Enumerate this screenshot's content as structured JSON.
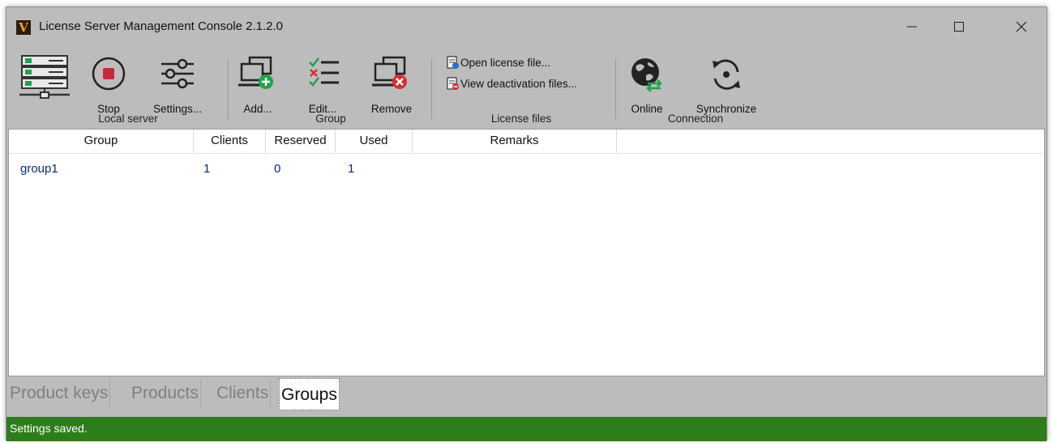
{
  "window": {
    "title": "License Server Management Console 2.1.2.0",
    "controls": {
      "minimize": "minimize-icon",
      "maximize": "maximize-icon",
      "close": "close-icon"
    }
  },
  "ribbon": {
    "local_server": {
      "label": "Local server",
      "server_icon": "server-icon",
      "stop": "Stop",
      "settings": "Settings..."
    },
    "group": {
      "label": "Group",
      "add": "Add...",
      "edit": "Edit...",
      "remove": "Remove"
    },
    "license_files": {
      "label": "License files",
      "open": "Open license file...",
      "view_deactivation": "View deactivation files..."
    },
    "connection": {
      "label": "Connection",
      "online": "Online",
      "synchronize": "Synchronize"
    }
  },
  "table": {
    "columns": [
      "Group",
      "Clients",
      "Reserved",
      "Used",
      "Remarks"
    ],
    "rows": [
      {
        "group": "group1",
        "clients": "1",
        "reserved": "0",
        "used": "1",
        "remarks": ""
      }
    ]
  },
  "tabs": [
    "Product keys",
    "Products",
    "Clients",
    "Groups"
  ],
  "active_tab": "Groups",
  "status": {
    "text": "Settings saved.",
    "color": "#2e7d1b"
  },
  "colors": {
    "accent_green": "#1fa34a",
    "stop_red": "#c8283c",
    "remove_red": "#d5302f",
    "link_blue": "#0b2a78"
  }
}
